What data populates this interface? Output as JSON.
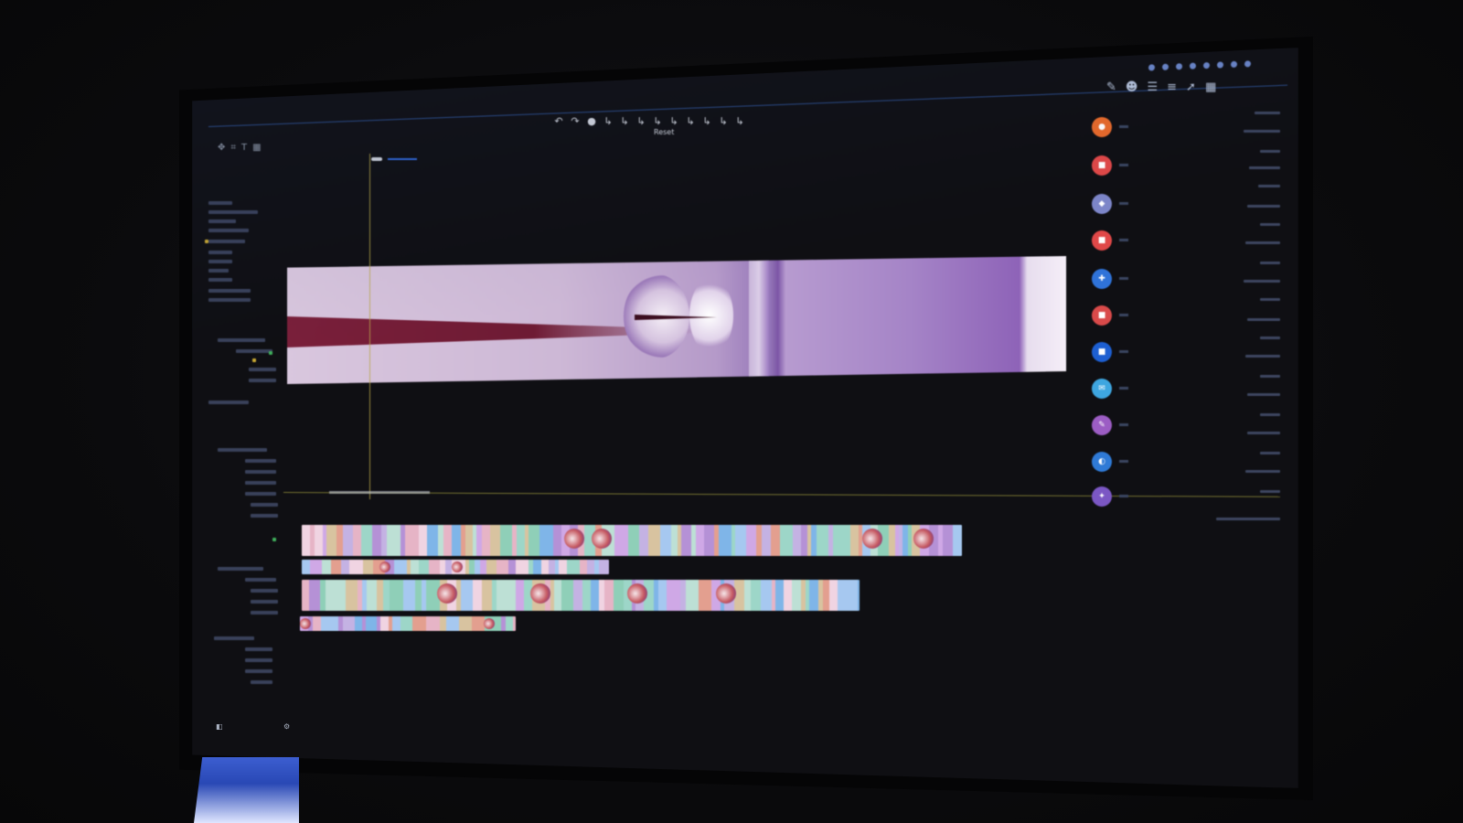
{
  "window": {
    "title": "",
    "menu": [
      "",
      "",
      "",
      "",
      "",
      "",
      "",
      ""
    ]
  },
  "toolbar": {
    "tools": [
      "↶",
      "↷",
      "●",
      "↳",
      "↳",
      "↳",
      "↳",
      "↳",
      "↳",
      "↳",
      "↳",
      "↳"
    ],
    "reset_label": "Reset"
  },
  "viewer": {
    "description_colors": {
      "frame_light": "#d9c7de",
      "frame_purple": "#8e63b8",
      "needle": "#7a1f3a"
    }
  },
  "icons": {
    "app_icon_colors": [
      "#e86a2a",
      "#e04848",
      "#7d86c9",
      "#e04848",
      "#2f73d9",
      "#d94a4a",
      "#1d5fd1",
      "#3ea6e0",
      "#9c5dc4",
      "#2f7ad6",
      "#7b57c4"
    ],
    "right_tool_icons": [
      "pen-icon",
      "user-icon",
      "layers-icon",
      "align-icon",
      "cursor-icon",
      "grid-icon"
    ]
  },
  "timeline": {
    "accent": "#b8a84a"
  }
}
